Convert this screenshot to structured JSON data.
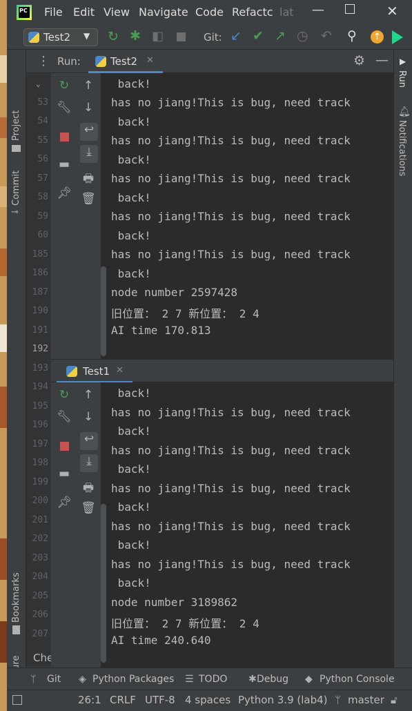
{
  "title_menu": [
    "File",
    "Edit",
    "View",
    "Navigate",
    "Code",
    "Refactc",
    "lat"
  ],
  "toolbar": {
    "run_config": "Test2",
    "git_label": "Git:"
  },
  "side_left": {
    "project": "Project",
    "commit": "Commit",
    "bookmarks": "Bookmarks",
    "structure": "Structure"
  },
  "side_right": {
    "run": "Run",
    "notifications": "Notifications"
  },
  "run_header": {
    "label": "Run:",
    "tab": "Test2"
  },
  "second_tab": "Test1",
  "gutter_lines": [
    "53",
    "54",
    "55",
    "56",
    "57",
    "58",
    "59",
    "60",
    "185",
    "186",
    "187",
    "190",
    "191",
    "192",
    "193",
    "194",
    "195",
    "196",
    "197",
    "198",
    "199",
    "200",
    "201",
    "202",
    "203",
    "204",
    "205",
    "206",
    "207"
  ],
  "console1": [
    " back!",
    "has no jiang!This is bug, need track",
    " back!",
    "has no jiang!This is bug, need track",
    " back!",
    "has no jiang!This is bug, need track",
    " back!",
    "has no jiang!This is bug, need track",
    " back!",
    "has no jiang!This is bug, need track",
    " back!",
    "node number 2597428",
    "旧位置： 2 7 新位置： 2 4",
    "AI time 170.813"
  ],
  "console2": [
    " back!",
    "has no jiang!This is bug, need track",
    " back!",
    "has no jiang!This is bug, need track",
    " back!",
    "has no jiang!This is bug, need track",
    " back!",
    "has no jiang!This is bug, need track",
    " back!",
    "has no jiang!This is bug, need track",
    " back!",
    "node number 3189862",
    "旧位置： 2 7 新位置： 2 4",
    "AI time 240.640"
  ],
  "editor_fragment": "Che",
  "bottom_tabs": {
    "git": "Git",
    "packages": "Python Packages",
    "todo": "TODO",
    "debug": "Debug",
    "console": "Python Console"
  },
  "status": {
    "position": "26:1",
    "line_sep": "CRLF",
    "encoding": "UTF-8",
    "indent": "4 spaces",
    "interpreter": "Python 3.9 (lab4)",
    "branch": "master"
  },
  "colors": {
    "accent": "#4a88c7",
    "run_green": "#499c54",
    "stop_red": "#c75450",
    "update_orange": "#f0a732"
  }
}
